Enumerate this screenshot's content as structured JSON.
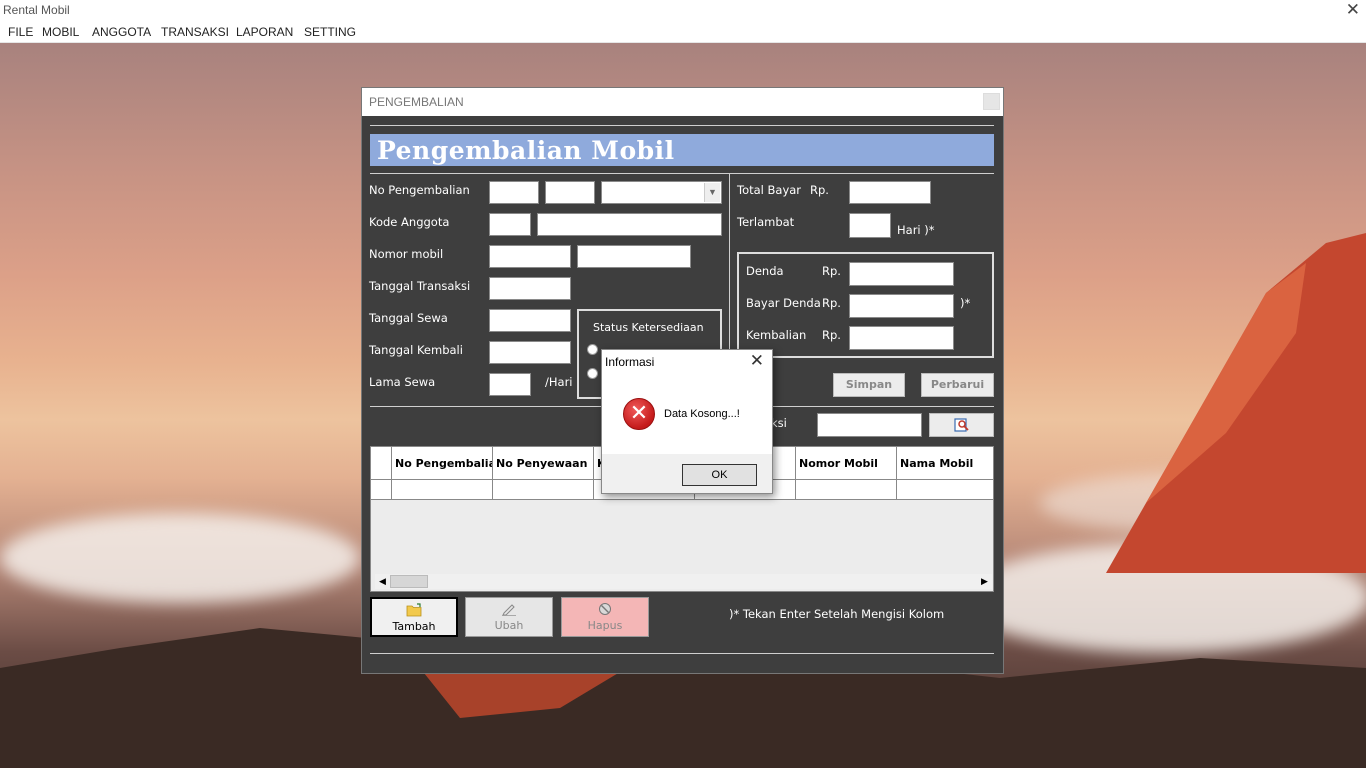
{
  "app": {
    "title": "Rental Mobil",
    "close_glyph": "✕"
  },
  "menu": [
    "FILE",
    "MOBIL",
    "ANGGOTA",
    "TRANSAKSI",
    "LAPORAN",
    "SETTING"
  ],
  "form": {
    "window_title": "PENGEMBALIAN",
    "heading": "Pengembalian Mobil",
    "labels": {
      "no_pengembalian": "No Pengembalian",
      "kode_anggota": "Kode Anggota",
      "nomor_mobil": "Nomor mobil",
      "tanggal_transaksi": "Tanggal Transaksi",
      "tanggal_sewa": "Tanggal Sewa",
      "tanggal_kembali": "Tanggal Kembali",
      "lama_sewa": "Lama Sewa",
      "per_hari": "/Hari",
      "status_ketersediaan": "Status Ketersediaan",
      "total_bayar": "Total Bayar",
      "rp": "Rp.",
      "terlambat": "Terlambat",
      "hari_star": "Hari )*",
      "denda": "Denda",
      "bayar_denda": "Bayar Denda",
      "star": ")*",
      "kembalian": "Kembalian",
      "search_suffix": "ksi",
      "note": ")* Tekan Enter Setelah Mengisi Kolom"
    },
    "buttons": {
      "simpan": "Simpan",
      "perbarui": "Perbarui",
      "tambah": "Tambah",
      "ubah": "Ubah",
      "hapus": "Hapus"
    },
    "grid": {
      "columns": [
        "No Pengembalian",
        "No Penyewaan",
        "K",
        "",
        "Nomor Mobil",
        "Nama Mobil"
      ]
    }
  },
  "dialog": {
    "title": "Informasi",
    "message": "Data Kosong...!",
    "ok_label": "OK",
    "icon": "error-icon"
  },
  "colors": {
    "banner": "#8faadc",
    "form_bg": "#3e3e3e",
    "hapus_bg": "#f4b6b6"
  }
}
